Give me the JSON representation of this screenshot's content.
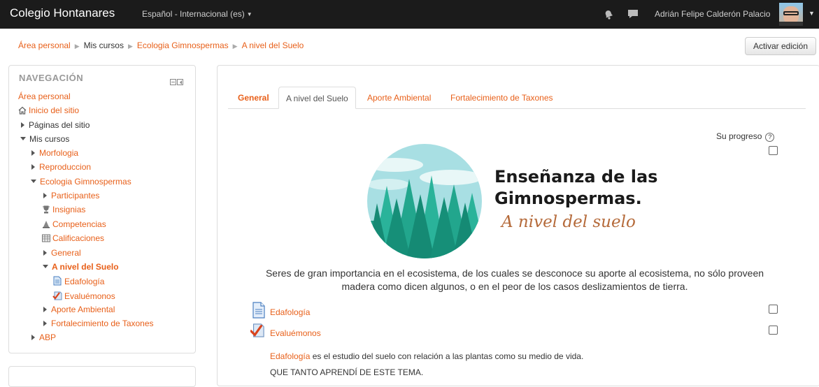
{
  "navbar": {
    "brand": "Colegio Hontanares",
    "language": "Español - Internacional (es)",
    "user_name": "Adrián Felipe Calderón Palacio"
  },
  "breadcrumb": {
    "items": [
      "Área personal",
      "Mis cursos",
      "Ecologia Gimnospermas",
      "A nivel del Suelo"
    ]
  },
  "edit_button": "Activar edición",
  "navigation": {
    "title": "NAVEGACIÓN",
    "items": [
      {
        "label": "Área personal"
      },
      {
        "label": "Inicio del sitio",
        "icon": "home-icon"
      },
      {
        "label": "Páginas del sitio"
      },
      {
        "label": "Mis cursos"
      },
      {
        "label": "Morfologia"
      },
      {
        "label": "Reproduccion"
      },
      {
        "label": "Ecologia Gimnospermas"
      },
      {
        "label": "Participantes"
      },
      {
        "label": "Insignias",
        "icon": "trophy-icon"
      },
      {
        "label": "Competencias",
        "icon": "competencies-icon"
      },
      {
        "label": "Calificaciones",
        "icon": "grades-table-icon"
      },
      {
        "label": "General"
      },
      {
        "label": "A nivel del Suelo"
      },
      {
        "label": "Edafología",
        "icon": "page-icon"
      },
      {
        "label": "Evaluémonos",
        "icon": "quiz-icon"
      },
      {
        "label": "Aporte Ambiental"
      },
      {
        "label": "Fortalecimiento de Taxones"
      },
      {
        "label": "ABP"
      }
    ]
  },
  "tabs": [
    "General",
    "A nivel del Suelo",
    "Aporte Ambiental",
    "Fortalecimiento de Taxones"
  ],
  "progress_label": "Su progreso",
  "banner": {
    "title_line1": "Enseñanza de las",
    "title_line2": "Gimnospermas.",
    "subtitle": "A nivel del suelo"
  },
  "description": "Seres de gran importancia en el ecosistema, de los cuales se desconoce su aporte al ecosistema, no sólo proveen madera como dicen algunos, o en el peor de los casos deslizamientos de tierra.",
  "activities": [
    {
      "label": "Edafología",
      "icon": "page-icon"
    },
    {
      "label": "Evaluémonos",
      "icon": "quiz-icon"
    }
  ],
  "summary": {
    "link": "Edafología",
    "text": " es el estudio del suelo con relación a las plantas como su medio de vida."
  },
  "quiz_note": "QUE TANTO APRENDÍ DE ESTE TEMA.",
  "colors": {
    "accent": "#e8601a",
    "navbar": "#1b1b1b"
  }
}
